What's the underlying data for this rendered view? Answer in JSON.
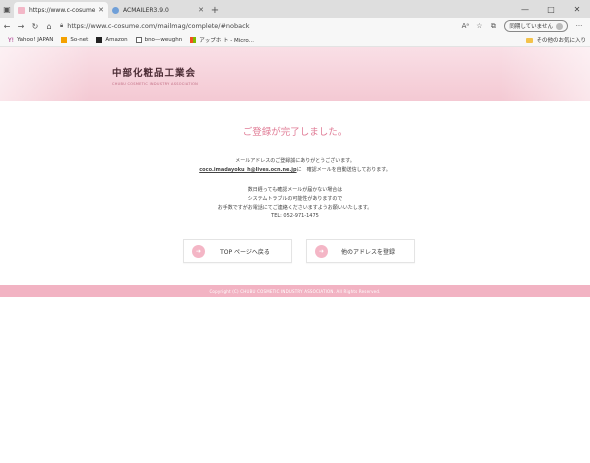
{
  "browser": {
    "tabs": [
      {
        "title": "https://www.c-cosume.com/mai",
        "active": true
      },
      {
        "title": "ACMAILER3.9.0",
        "active": false
      }
    ],
    "new_tab_label": "+",
    "window_controls": {
      "minimize": "—",
      "maximize": "□",
      "close": "✕"
    },
    "url": "https://www.c-cosume.com/mailmag/complete/#noback",
    "sync_label": "同期していません",
    "favorites": [
      {
        "label": "Yahoo! JAPAN",
        "icon": "yahoo-icon"
      },
      {
        "label": "So-net",
        "icon": "sonet-icon"
      },
      {
        "label": "Amazon",
        "icon": "amazon-icon"
      },
      {
        "label": "bno—weughn",
        "icon": "page-icon"
      },
      {
        "label": "アップホ ト - Micro...",
        "icon": "microsoft-icon"
      }
    ],
    "other_favorites": "その他のお気に入り"
  },
  "site": {
    "logo_title": "中部化粧品工業会",
    "logo_subtitle": "CHUBU COSMETIC INDUSTRY ASSOCIATION"
  },
  "message": {
    "title": "ご登録が完了しました。",
    "thanks": "メールアドレスのご登録誠にありがとうございます。",
    "email_address": "coco.imadayoku_h@lives.ocn.ne.jp",
    "email_suffix": "に　確認メールを自動送信しております。",
    "note1": "数日経っても確認メールが届かない場合は",
    "note2": "システムトラブルの可能性がありますので",
    "note3": "お手数ですがお電話にてご連絡くださいますようお願いいたします。",
    "tel": "TEL: 052-971-1475"
  },
  "buttons": {
    "top": "TOP ページへ戻る",
    "other": "他のアドレスを登録"
  },
  "footer": {
    "copyright": "Copyright (C) CHUBU COSMETIC INDUSTRY ASSOCIATION. All Rights Reserved."
  }
}
